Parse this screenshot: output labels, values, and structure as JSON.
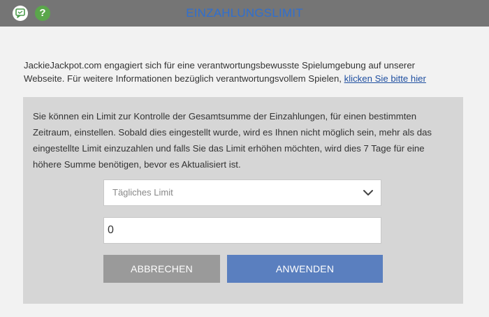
{
  "header": {
    "title": "EINZAHLUNGSLIMIT",
    "icons": [
      "chat-icon",
      "help-icon"
    ],
    "help_glyph": "?"
  },
  "intro": {
    "text": "JackieJackpot.com engagiert sich für eine verantwortungsbewusste Spielumgebung auf unserer Webseite. Für weitere Informationen bezüglich verantwortungsvollem Spielen, ",
    "link_text": "klicken Sie bitte hier"
  },
  "panel": {
    "text": "Sie können ein Limit zur Kontrolle der Gesamtsumme der Einzahlungen, für einen bestimmten Zeitraum, einstellen. Sobald dies eingestellt wurde, wird es Ihnen nicht möglich sein, mehr als das eingestellte Limit einzuzahlen und falls Sie das Limit erhöhen möchten, wird dies 7 Tage für eine höhere Summe benötigen, bevor es Aktualisiert ist.",
    "select": {
      "selected": "Tägliches Limit"
    },
    "amount_input": {
      "value": "0"
    },
    "buttons": {
      "cancel_label": "ABBRECHEN",
      "apply_label": "ANWENDEN"
    }
  },
  "colors": {
    "header_bg": "#757575",
    "title": "#2f6fd0",
    "panel_bg": "#d6d6d6",
    "cancel_bg": "#9a9a9a",
    "apply_bg": "#5a7fbf",
    "help_bg": "#5aa64b"
  }
}
